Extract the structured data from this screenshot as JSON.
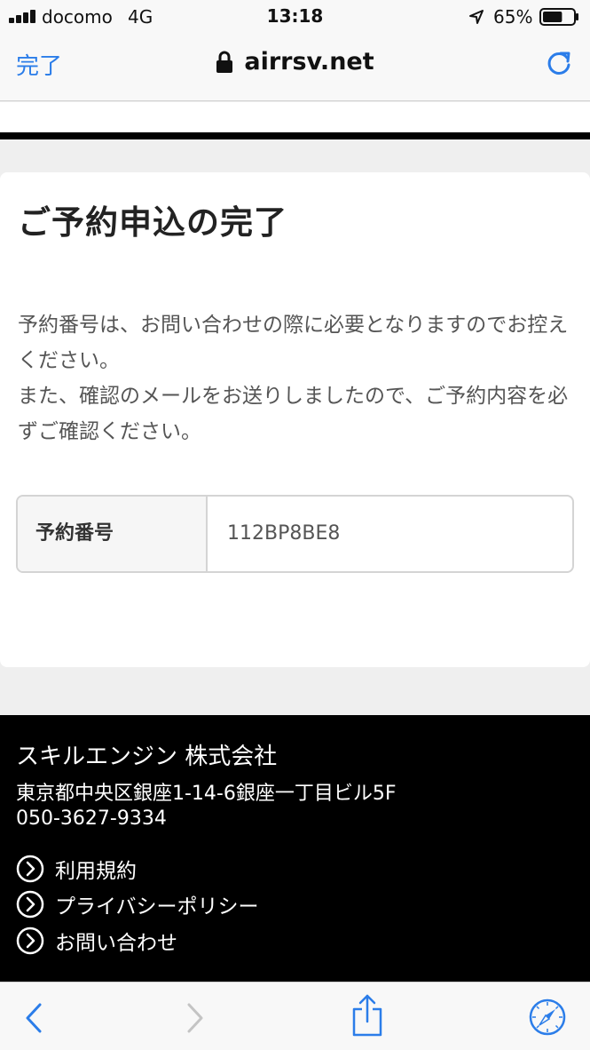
{
  "status_bar": {
    "carrier": "docomo",
    "network": "4G",
    "time": "13:18",
    "battery": "65%",
    "battery_level": 0.65
  },
  "browser": {
    "done_label": "完了",
    "url": "airrsv.net"
  },
  "page": {
    "title": "ご予約申込の完了",
    "message_lines": [
      "予約番号は、お問い合わせの際に必要となりますのでお控えください。",
      "また、確認のメールをお送りしましたので、ご予約内容を必ずご確認ください。"
    ],
    "reservation": {
      "label": "予約番号",
      "value": "112BP8BE8"
    }
  },
  "footer": {
    "company": "スキルエンジン 株式会社",
    "address": "東京都中央区銀座1-14-6銀座一丁目ビル5F",
    "phone": "050-3627-9334",
    "links": [
      "利用規約",
      "プライバシーポリシー",
      "お問い合わせ"
    ]
  },
  "toolbar": {
    "icons": [
      "back-icon",
      "forward-icon",
      "share-icon",
      "compass-icon"
    ]
  },
  "colors": {
    "accent": "#2b7de9",
    "footer_bg": "#000000",
    "page_bg": "#efefef"
  }
}
